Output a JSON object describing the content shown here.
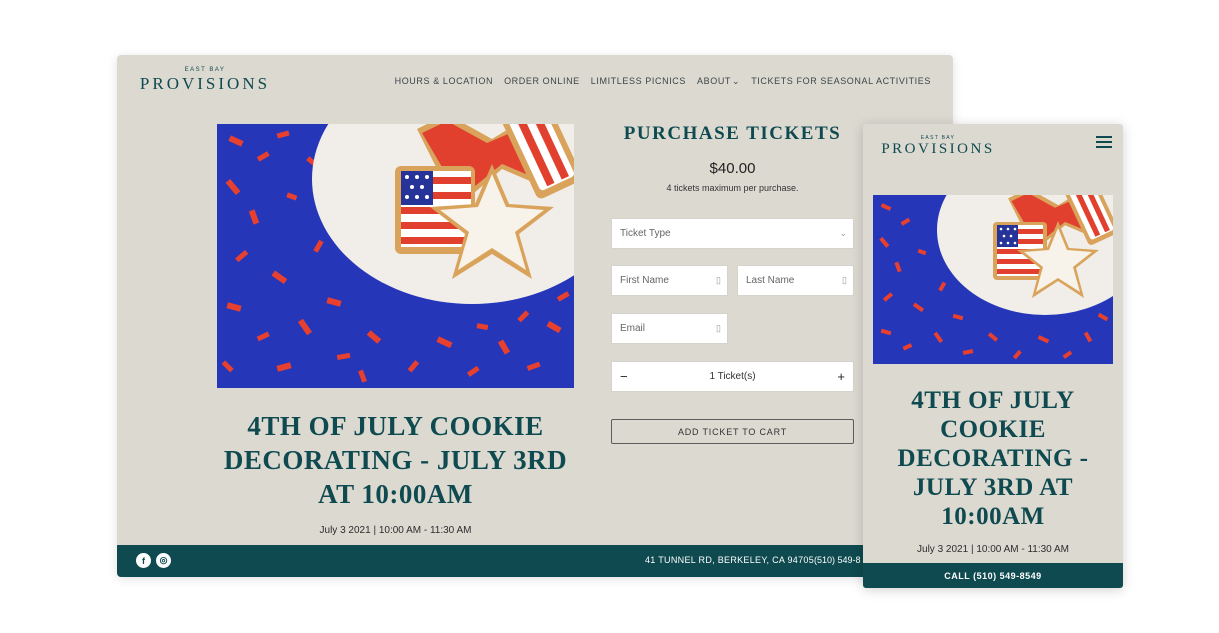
{
  "brand": {
    "small": "EAST BAY",
    "name": "PROVISIONS"
  },
  "nav": {
    "items": [
      "HOURS & LOCATION",
      "ORDER ONLINE",
      "LIMITLESS PICNICS",
      "ABOUT",
      "TICKETS FOR SEASONAL ACTIVITIES"
    ]
  },
  "event": {
    "title": "4TH OF JULY COOKIE DECORATING - JULY 3RD AT 10:00AM",
    "date": "July 3 2021 | 10:00 AM - 11:30 AM",
    "image_description_icon": "cookie-photo"
  },
  "purchase": {
    "heading": "PURCHASE TICKETS",
    "price": "$40.00",
    "limit_note": "4 tickets maximum per purchase.",
    "ticket_type_placeholder": "Ticket Type",
    "first_name_placeholder": "First Name",
    "last_name_placeholder": "Last Name",
    "email_placeholder": "Email",
    "quantity_label": "1 Ticket(s)",
    "minus": "−",
    "plus": "+",
    "add_button": "ADD TICKET TO CART"
  },
  "footer": {
    "address": "41 TUNNEL RD, BERKELEY, CA 94705",
    "phone": "(510) 549-8",
    "social": [
      "facebook-icon",
      "instagram-icon"
    ]
  },
  "mobile": {
    "call_button": "CALL (510) 549-8549"
  },
  "colors": {
    "teal": "#0e4a4f",
    "page_bg": "#dcd9d1"
  }
}
